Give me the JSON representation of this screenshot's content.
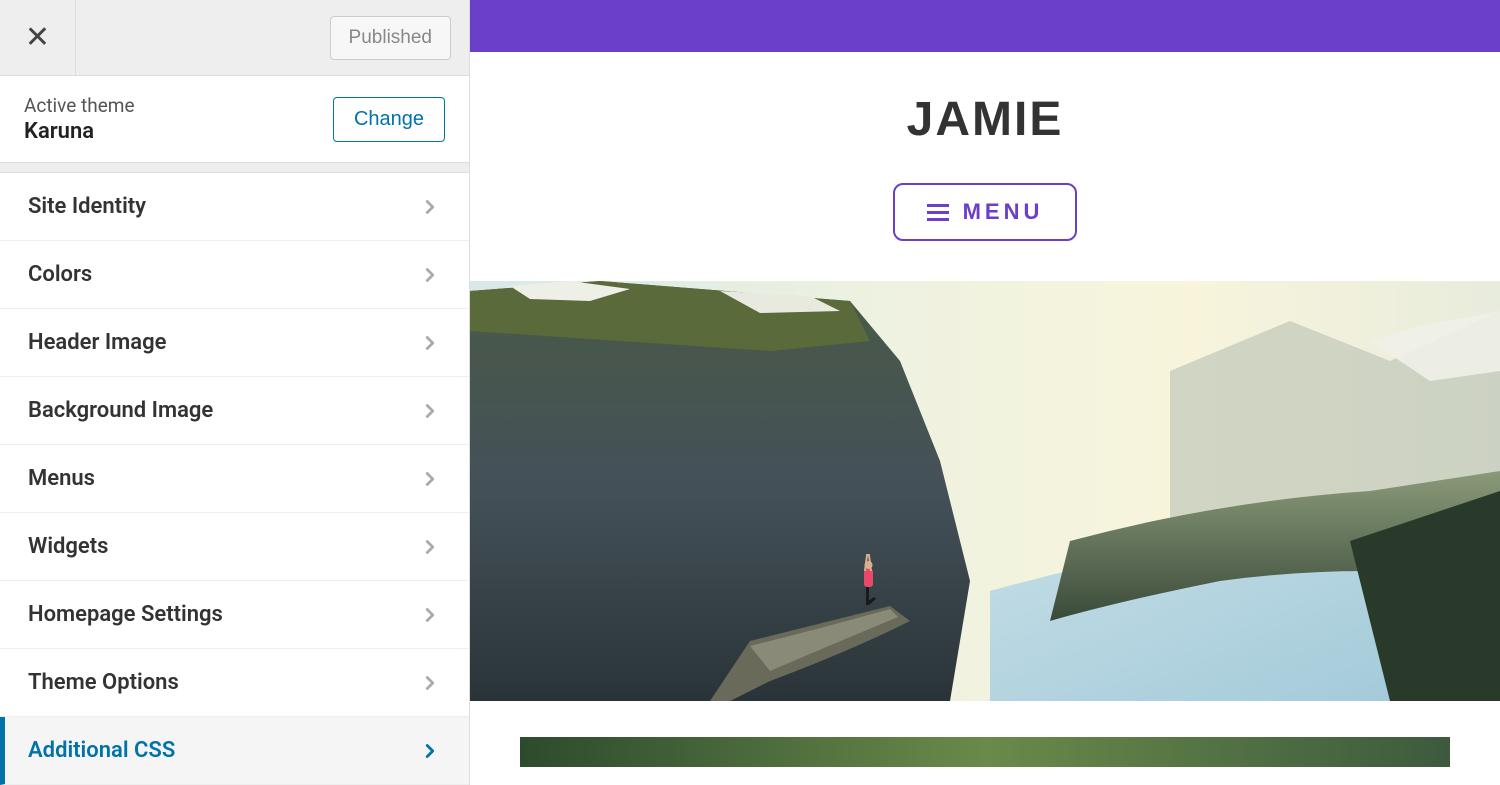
{
  "topbar": {
    "published_label": "Published"
  },
  "theme": {
    "active_label": "Active theme",
    "name": "Karuna",
    "change_label": "Change"
  },
  "panels": [
    {
      "label": "Site Identity",
      "active": false
    },
    {
      "label": "Colors",
      "active": false
    },
    {
      "label": "Header Image",
      "active": false
    },
    {
      "label": "Background Image",
      "active": false
    },
    {
      "label": "Menus",
      "active": false
    },
    {
      "label": "Widgets",
      "active": false
    },
    {
      "label": "Homepage Settings",
      "active": false
    },
    {
      "label": "Theme Options",
      "active": false
    },
    {
      "label": "Additional CSS",
      "active": true
    }
  ],
  "preview": {
    "site_title": "JAMIE",
    "menu_label": "MENU",
    "accent_color": "#6b3fc9"
  }
}
